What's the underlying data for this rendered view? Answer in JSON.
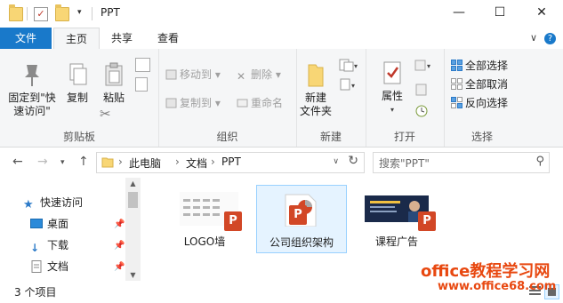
{
  "window": {
    "title": "PPT",
    "minimize": "—",
    "maximize": "☐",
    "close": "✕"
  },
  "ribbon_tabs": {
    "file": "文件",
    "home": "主页",
    "share": "共享",
    "view": "查看",
    "collapse": "∨",
    "help": "?"
  },
  "ribbon": {
    "clipboard": {
      "pin_label": "固定到\"快速访问\"",
      "copy": "复制",
      "paste": "粘贴",
      "group": "剪贴板"
    },
    "organize": {
      "move_to": "移动到",
      "copy_to": "复制到",
      "delete": "删除",
      "rename": "重命名",
      "group": "组织"
    },
    "new": {
      "new_folder": "新建\n文件夹",
      "group": "新建"
    },
    "open": {
      "properties": "属性",
      "group": "打开"
    },
    "select": {
      "select_all": "全部选择",
      "select_none": "全部取消",
      "invert": "反向选择",
      "group": "选择"
    }
  },
  "address": {
    "crumbs": [
      "此电脑",
      "文档",
      "PPT"
    ],
    "search_placeholder": "搜索\"PPT\""
  },
  "nav": {
    "items": [
      "快速访问",
      "桌面",
      "下载",
      "文档"
    ]
  },
  "files": [
    {
      "name": "LOGO墙",
      "selected": false
    },
    {
      "name": "公司组织架构",
      "selected": true
    },
    {
      "name": "课程广告",
      "selected": false
    }
  ],
  "status": {
    "count": "3 个项目"
  },
  "watermark": {
    "brand": "office教程学习网",
    "url": "www.office68.com"
  },
  "colors": {
    "accent": "#1979ca",
    "ppt": "#d24726",
    "watermark": "#e84810"
  }
}
